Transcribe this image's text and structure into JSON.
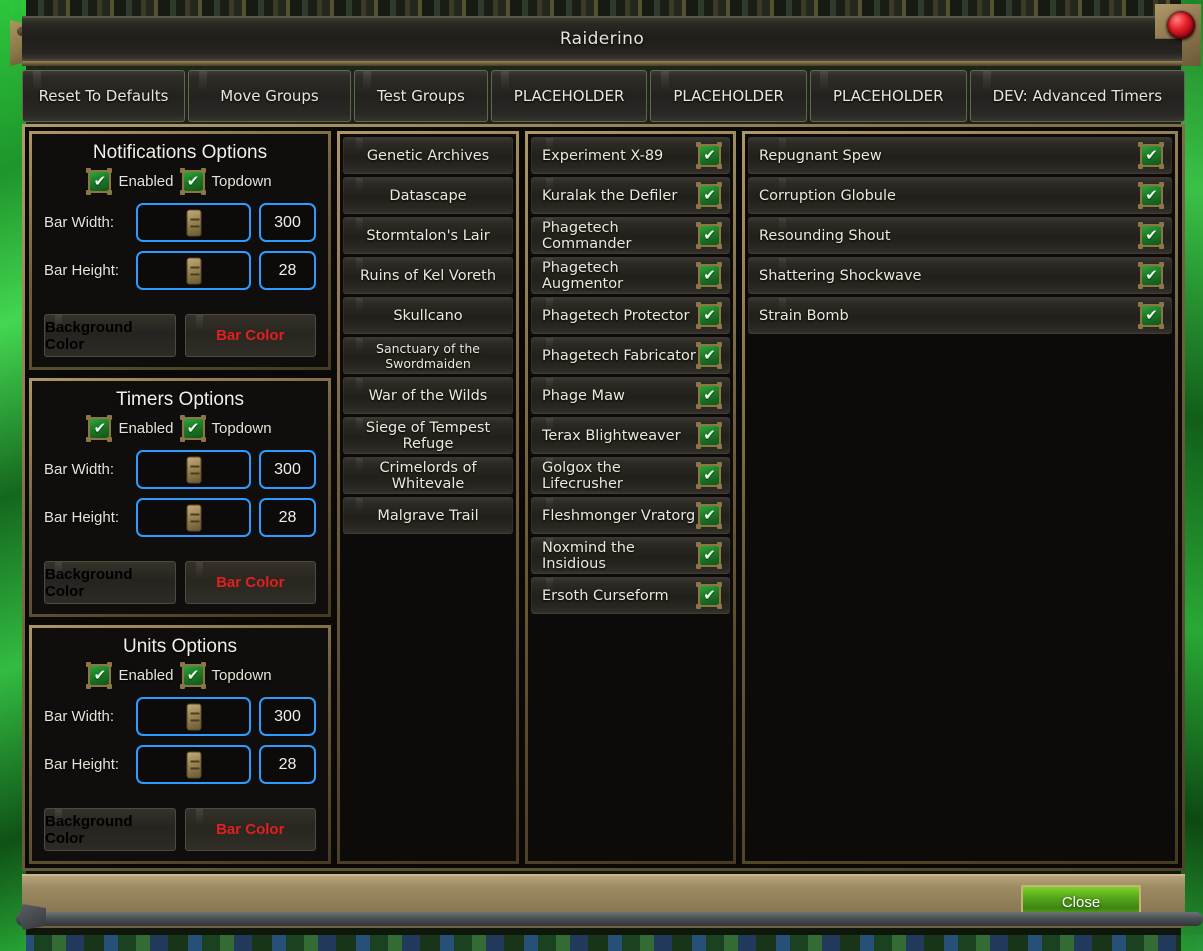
{
  "window": {
    "title": "Raiderino",
    "corner_jewel_color": "#e8202a"
  },
  "tabs": [
    {
      "label": "Reset To Defaults"
    },
    {
      "label": "Move Groups"
    },
    {
      "label": "Test Groups"
    },
    {
      "label": "PLACEHOLDER"
    },
    {
      "label": "PLACEHOLDER"
    },
    {
      "label": "PLACEHOLDER"
    },
    {
      "label": "DEV: Advanced Timers"
    }
  ],
  "option_panels": [
    {
      "title": "Notifications Options",
      "enabled_label": "Enabled",
      "enabled_checked": true,
      "topdown_label": "Topdown",
      "topdown_checked": true,
      "bar_width_label": "Bar Width:",
      "bar_width_value": "300",
      "bar_height_label": "Bar Height:",
      "bar_height_value": "28",
      "background_color_label": "Background Color",
      "bar_color_label": "Bar Color",
      "background_color_swatch": "#000000",
      "bar_color_swatch": "#e02020"
    },
    {
      "title": "Timers Options",
      "enabled_label": "Enabled",
      "enabled_checked": true,
      "topdown_label": "Topdown",
      "topdown_checked": true,
      "bar_width_label": "Bar Width:",
      "bar_width_value": "300",
      "bar_height_label": "Bar Height:",
      "bar_height_value": "28",
      "background_color_label": "Background Color",
      "bar_color_label": "Bar Color",
      "background_color_swatch": "#000000",
      "bar_color_swatch": "#e02020"
    },
    {
      "title": "Units Options",
      "enabled_label": "Enabled",
      "enabled_checked": true,
      "topdown_label": "Topdown",
      "topdown_checked": true,
      "bar_width_label": "Bar Width:",
      "bar_width_value": "300",
      "bar_height_label": "Bar Height:",
      "bar_height_value": "28",
      "background_color_label": "Background Color",
      "bar_color_label": "Bar Color",
      "background_color_swatch": "#000000",
      "bar_color_swatch": "#e02020"
    }
  ],
  "zones": [
    {
      "label": "Genetic Archives",
      "small": false
    },
    {
      "label": "Datascape",
      "small": false
    },
    {
      "label": "Stormtalon's Lair",
      "small": false
    },
    {
      "label": "Ruins of Kel Voreth",
      "small": false
    },
    {
      "label": "Skullcano",
      "small": false
    },
    {
      "label": "Sanctuary of the Swordmaiden",
      "small": true
    },
    {
      "label": "War of the Wilds",
      "small": false
    },
    {
      "label": "Siege of Tempest Refuge",
      "small": false
    },
    {
      "label": "Crimelords of Whitevale",
      "small": false
    },
    {
      "label": "Malgrave Trail",
      "small": false
    }
  ],
  "bosses": [
    {
      "label": "Experiment X-89",
      "checked": true
    },
    {
      "label": "Kuralak the Defiler",
      "checked": true
    },
    {
      "label": "Phagetech Commander",
      "checked": true
    },
    {
      "label": "Phagetech Augmentor",
      "checked": true
    },
    {
      "label": "Phagetech Protector",
      "checked": true
    },
    {
      "label": "Phagetech Fabricator",
      "checked": true
    },
    {
      "label": "Phage Maw",
      "checked": true
    },
    {
      "label": "Terax Blightweaver",
      "checked": true
    },
    {
      "label": "Golgox the Lifecrusher",
      "checked": true
    },
    {
      "label": "Fleshmonger Vratorg",
      "checked": true
    },
    {
      "label": "Noxmind the Insidious",
      "checked": true
    },
    {
      "label": "Ersoth Curseform",
      "checked": true
    }
  ],
  "abilities": [
    {
      "label": "Repugnant Spew",
      "checked": true
    },
    {
      "label": "Corruption Globule",
      "checked": true
    },
    {
      "label": "Resounding Shout",
      "checked": true
    },
    {
      "label": "Shattering Shockwave",
      "checked": true
    },
    {
      "label": "Strain Bomb",
      "checked": true
    }
  ],
  "footer": {
    "close_label": "Close"
  },
  "icons": {
    "check": "✔",
    "jewel": "gem-icon"
  }
}
